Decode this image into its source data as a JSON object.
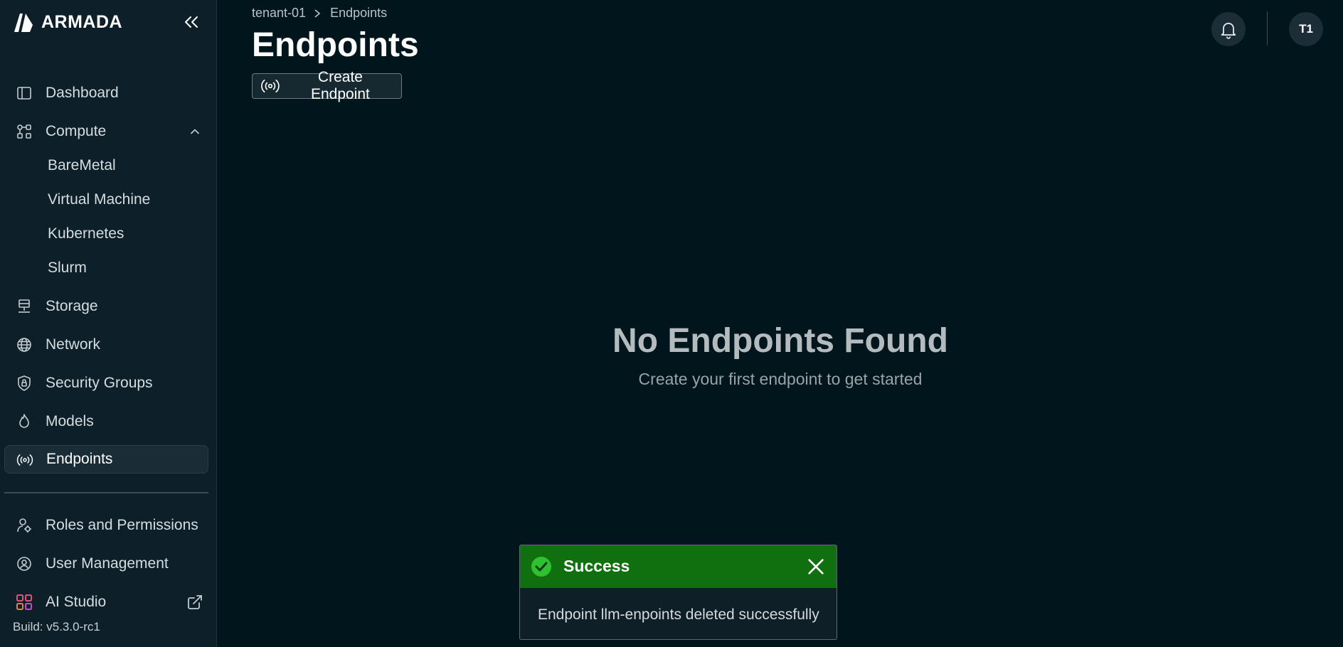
{
  "app": {
    "logo_text": "ARMADA",
    "build": "Build: v5.3.0-rc1"
  },
  "sidebar": {
    "items": [
      {
        "label": "Dashboard",
        "icon": "dashboard-panel-icon"
      },
      {
        "label": "Compute",
        "icon": "compute-nodes-icon",
        "expanded": true
      },
      {
        "label": "Storage",
        "icon": "storage-icon"
      },
      {
        "label": "Network",
        "icon": "globe-icon"
      },
      {
        "label": "Security Groups",
        "icon": "lock-shield-icon"
      },
      {
        "label": "Models",
        "icon": "flame-icon"
      },
      {
        "label": "Endpoints",
        "icon": "broadcast-icon",
        "active": true
      },
      {
        "label": "Roles and Permissions",
        "icon": "users-gear-icon"
      },
      {
        "label": "User Management",
        "icon": "user-circle-icon"
      },
      {
        "label": "AI Studio",
        "icon": "ai-studio-grid-icon",
        "external": true
      }
    ],
    "compute_sub": [
      "BareMetal",
      "Virtual Machine",
      "Kubernetes",
      "Slurm"
    ]
  },
  "header": {
    "breadcrumb": [
      "tenant-01",
      "Endpoints"
    ],
    "title": "Endpoints",
    "create_button": "Create Endpoint",
    "avatar_initials": "T1"
  },
  "empty_state": {
    "title": "No Endpoints Found",
    "subtitle": "Create your first endpoint to get started"
  },
  "toast": {
    "title": "Success",
    "message": "Endpoint llm-enpoints deleted successfully",
    "color": "#107010"
  },
  "colors": {
    "background": "#01151c",
    "sidebar": "#0d1f28",
    "accent_success": "#107010"
  }
}
